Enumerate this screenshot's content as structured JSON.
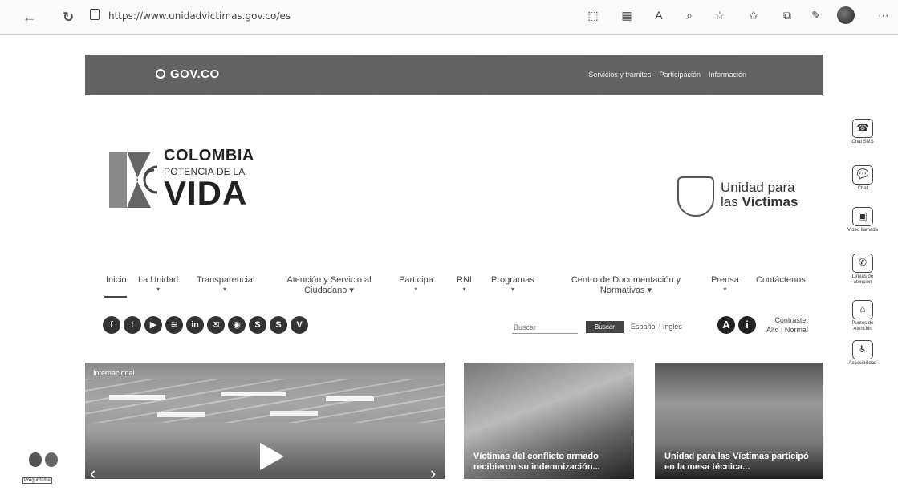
{
  "browser": {
    "url": "https://www.unidadvictimas.gov.co/es",
    "back_icon": "back-arrow-icon",
    "reload_icon": "reload-icon"
  },
  "govbar": {
    "logo": "GOV.CO",
    "links": [
      "Servicios y trámites",
      "Participación",
      "Información"
    ]
  },
  "brand": {
    "colombia_line1": "COLOMBIA",
    "colombia_line2": "POTENCIA DE LA",
    "colombia_line3": "VIDA",
    "unidad_line1": "Unidad para",
    "unidad_line2a": "las ",
    "unidad_line2b": "Víctimas"
  },
  "menu": [
    {
      "label": "Inicio",
      "caret": ""
    },
    {
      "label": "La Unidad",
      "caret": "▾"
    },
    {
      "label": "Transparencia",
      "caret": "▾"
    },
    {
      "label": "Atención y Servicio al Ciudadano ▾",
      "caret": ""
    },
    {
      "label": "Participa",
      "caret": "▾"
    },
    {
      "label": "RNI",
      "caret": "▾"
    },
    {
      "label": "Programas",
      "caret": "▾"
    },
    {
      "label": "Centro de Documentación y Normativas ▾",
      "caret": ""
    },
    {
      "label": "Prensa",
      "caret": "▾"
    },
    {
      "label": "Contáctenos",
      "caret": ""
    }
  ],
  "social": [
    "f",
    "t",
    "▶",
    "≋",
    "in",
    "✉",
    "◉",
    "S",
    "S",
    "V"
  ],
  "search": {
    "placeholder": "Buscar",
    "button": "Buscar"
  },
  "lang": "Español | Inglés",
  "accessibility": {
    "a_label": "A",
    "info_label": "i",
    "contrast_title": "Contraste:",
    "contrast_options": "Alto | Normal"
  },
  "news": {
    "hero_tag": "Internacional",
    "card2_title": "Víctimas del conflicto armado recibieron su indemnización...",
    "card3_title": "Unidad para las Víctimas participó en la mesa técnica..."
  },
  "side_tools": [
    {
      "icon": "☎",
      "label": "Chat SMS"
    },
    {
      "icon": "💬",
      "label": "Chat"
    },
    {
      "icon": "▣",
      "label": "Video llamada"
    },
    {
      "icon": "✆",
      "label": "Líneas de atención"
    },
    {
      "icon": "⌂",
      "label": "Puntos de Atención"
    },
    {
      "icon": "♿",
      "label": "Accesibilidad"
    }
  ],
  "assistant": {
    "label": "Preguntame"
  }
}
